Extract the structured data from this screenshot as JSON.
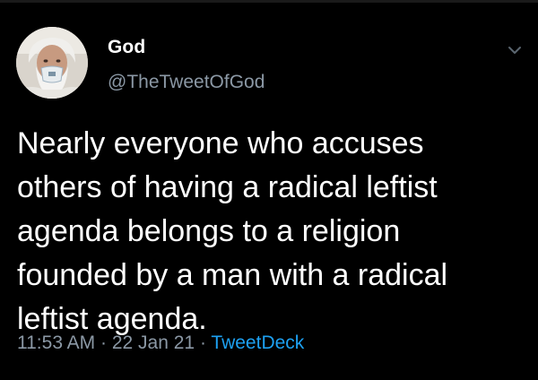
{
  "tweet": {
    "display_name": "God",
    "handle": "@TheTweetOfGod",
    "text": "Nearly everyone who accuses\nothers of having a radical leftist\nagenda belongs to a religion\nfounded by a man with a radical\nleftist agenda.",
    "time": "11:53 AM",
    "separator": "·",
    "date": "22 Jan 21",
    "source": "TweetDeck",
    "avatar_icon": "avatar-icon",
    "menu_icon": "chevron-down-icon"
  },
  "colors": {
    "background": "#000000",
    "text": "#ffffff",
    "muted": "#8b98a5",
    "link": "#1da1f2"
  }
}
